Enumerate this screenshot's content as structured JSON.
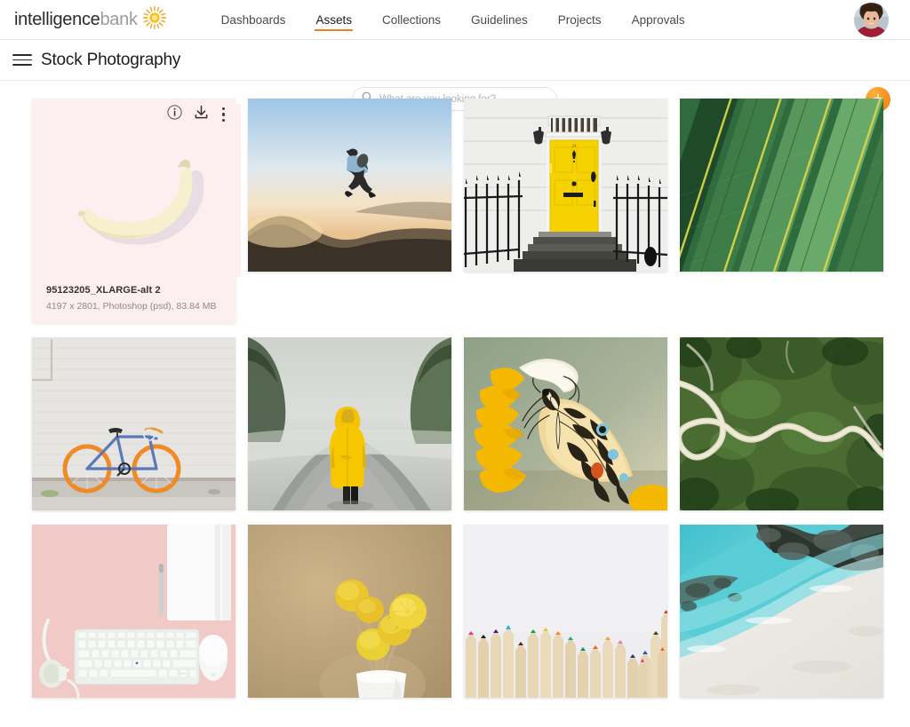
{
  "brand": {
    "name_primary": "intelligence",
    "name_secondary": "bank",
    "logo_icon": "sun-icon",
    "accent_color": "#f07d1e"
  },
  "topnav": {
    "items": [
      {
        "label": "Dashboards",
        "active": false
      },
      {
        "label": "Assets",
        "active": true
      },
      {
        "label": "Collections",
        "active": false
      },
      {
        "label": "Guidelines",
        "active": false
      },
      {
        "label": "Projects",
        "active": false
      },
      {
        "label": "Approvals",
        "active": false
      }
    ],
    "avatar_icon": "user-avatar"
  },
  "subheader": {
    "menu_icon": "hamburger-menu-icon",
    "title": "Stock Photography",
    "search": {
      "icon": "search-icon",
      "value": "",
      "placeholder": "What are you looking for?"
    },
    "add_button": {
      "icon": "plus-icon",
      "label": "+"
    }
  },
  "asset_actions": {
    "info_icon": "info-circle-icon",
    "download_icon": "download-icon",
    "more_icon": "more-vertical-icon"
  },
  "assets": [
    {
      "id": "asset-1",
      "selected": true,
      "title": "95123205_XLARGE-alt 2",
      "details": "4197 x 2801, Photoshop (psd), 83.84 MB",
      "thumb": "banana-on-pink",
      "bg": "#fdeef0"
    },
    {
      "id": "asset-2",
      "selected": false,
      "title": "",
      "details": "",
      "thumb": "man-jumping-at-sunset",
      "bg": "#cfe0ef"
    },
    {
      "id": "asset-3",
      "selected": false,
      "title": "",
      "details": "",
      "thumb": "yellow-door-townhouse",
      "bg": "#e9e9e7"
    },
    {
      "id": "asset-4",
      "selected": false,
      "title": "",
      "details": "",
      "thumb": "green-palm-leaves",
      "bg": "#2f6b3c"
    },
    {
      "id": "asset-5",
      "selected": false,
      "title": "",
      "details": "",
      "thumb": "bicycle-against-white-brick-wall",
      "bg": "#e5e5e3"
    },
    {
      "id": "asset-6",
      "selected": false,
      "title": "",
      "details": "",
      "thumb": "person-in-yellow-raincoat-foggy-road",
      "bg": "#c9ccc6"
    },
    {
      "id": "asset-7",
      "selected": false,
      "title": "",
      "details": "",
      "thumb": "butterfly-on-yellow-flower",
      "bg": "#93a18b"
    },
    {
      "id": "asset-8",
      "selected": false,
      "title": "",
      "details": "",
      "thumb": "aerial-winding-mountain-road",
      "bg": "#3f5c2c"
    },
    {
      "id": "asset-9",
      "selected": false,
      "title": "",
      "details": "",
      "thumb": "pink-desk-keyboard-flatlay",
      "bg": "#f2cfcd"
    },
    {
      "id": "asset-10",
      "selected": false,
      "title": "",
      "details": "",
      "thumb": "yellow-billy-button-flowers",
      "bg": "#bba578"
    },
    {
      "id": "asset-11",
      "selected": false,
      "title": "",
      "details": "",
      "thumb": "colored-pencils-row",
      "bg": "#f0eff1"
    },
    {
      "id": "asset-12",
      "selected": false,
      "title": "",
      "details": "",
      "thumb": "aerial-turquoise-beach",
      "bg": "#5fc8cf"
    }
  ]
}
